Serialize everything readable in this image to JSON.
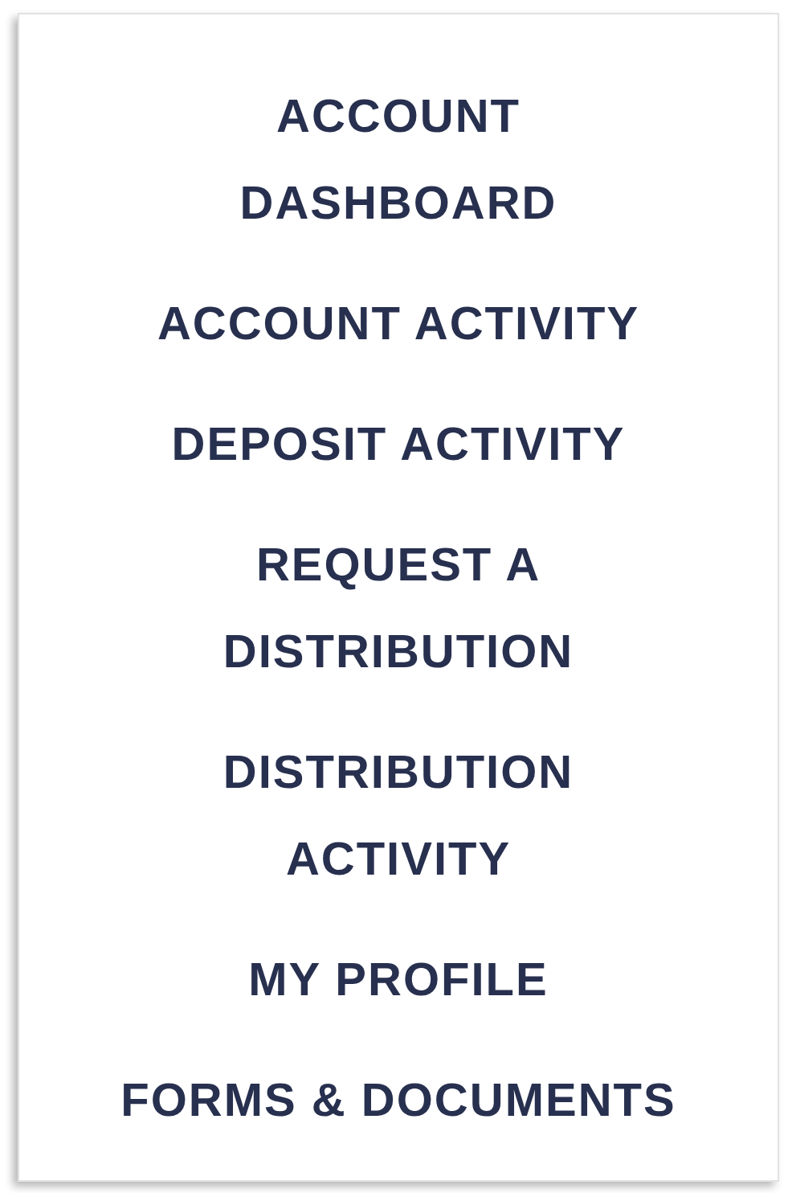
{
  "menu": {
    "items": [
      {
        "lines": [
          "ACCOUNT",
          "DASHBOARD"
        ]
      },
      {
        "lines": [
          "ACCOUNT ACTIVITY"
        ]
      },
      {
        "lines": [
          "DEPOSIT ACTIVITY"
        ]
      },
      {
        "lines": [
          "REQUEST A",
          "DISTRIBUTION"
        ]
      },
      {
        "lines": [
          "DISTRIBUTION",
          "ACTIVITY"
        ]
      },
      {
        "lines": [
          "MY PROFILE"
        ]
      },
      {
        "lines": [
          "FORMS & DOCUMENTS"
        ]
      }
    ]
  }
}
